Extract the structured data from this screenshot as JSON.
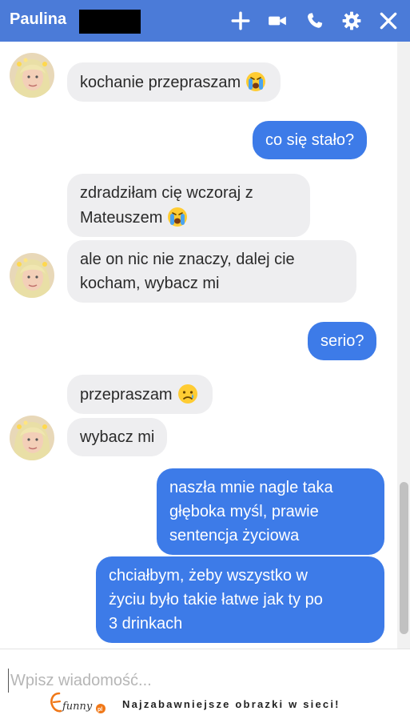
{
  "header": {
    "title": "Paulina",
    "icons": [
      "plus-icon",
      "video-icon",
      "phone-icon",
      "gear-icon",
      "close-icon"
    ]
  },
  "messages": [
    {
      "id": "m1",
      "side": "in",
      "text": "kochanie przepraszam",
      "emoji": "crying-face"
    },
    {
      "id": "m2",
      "side": "out",
      "text": "co się stało?"
    },
    {
      "id": "m3",
      "side": "in",
      "lines": [
        "zdradziłam cię wczoraj z",
        "Mateuszem"
      ],
      "emoji": "crying-face"
    },
    {
      "id": "m4",
      "side": "in",
      "lines": [
        "ale on nic nie znaczy, dalej cie",
        "kocham, wybacz mi"
      ]
    },
    {
      "id": "m5",
      "side": "out",
      "text": "serio?"
    },
    {
      "id": "m6",
      "side": "in",
      "text": "przepraszam",
      "emoji": "sad-tear-face"
    },
    {
      "id": "m7",
      "side": "in",
      "text": "wybacz mi"
    },
    {
      "id": "m8",
      "side": "out",
      "lines": [
        "naszła mnie nagle taka",
        "głęboka myśl, prawie",
        "sentencja życiowa"
      ]
    },
    {
      "id": "m9",
      "side": "out",
      "lines": [
        "chciałbym, żeby wszystko w",
        "życiu było takie łatwe jak ty po",
        "3 drinkach"
      ]
    }
  ],
  "composer": {
    "placeholder": "Wpisz wiadomość...",
    "value": ""
  },
  "footer": {
    "brand": "funny",
    "brand_suffix": "pl",
    "tagline": "Najzabawniejsze obrazki w sieci!"
  },
  "colors": {
    "header": "#4b7bd8",
    "outgoing": "#3d7be8",
    "incoming": "#eeeef0"
  }
}
